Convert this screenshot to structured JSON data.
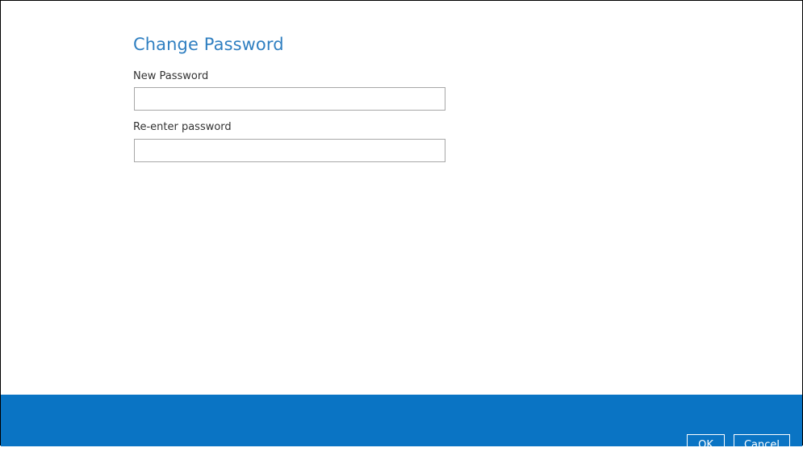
{
  "dialog": {
    "title": "Change Password"
  },
  "form": {
    "new_password": {
      "label": "New Password",
      "value": "",
      "placeholder": ""
    },
    "reenter_password": {
      "label": "Re-enter password",
      "value": "",
      "placeholder": ""
    }
  },
  "footer": {
    "ok_label": "OK",
    "cancel_label": "Cancel",
    "background_color": "#0a74c4"
  },
  "colors": {
    "title": "#2f7fc1",
    "accent": "#0a74c4"
  }
}
